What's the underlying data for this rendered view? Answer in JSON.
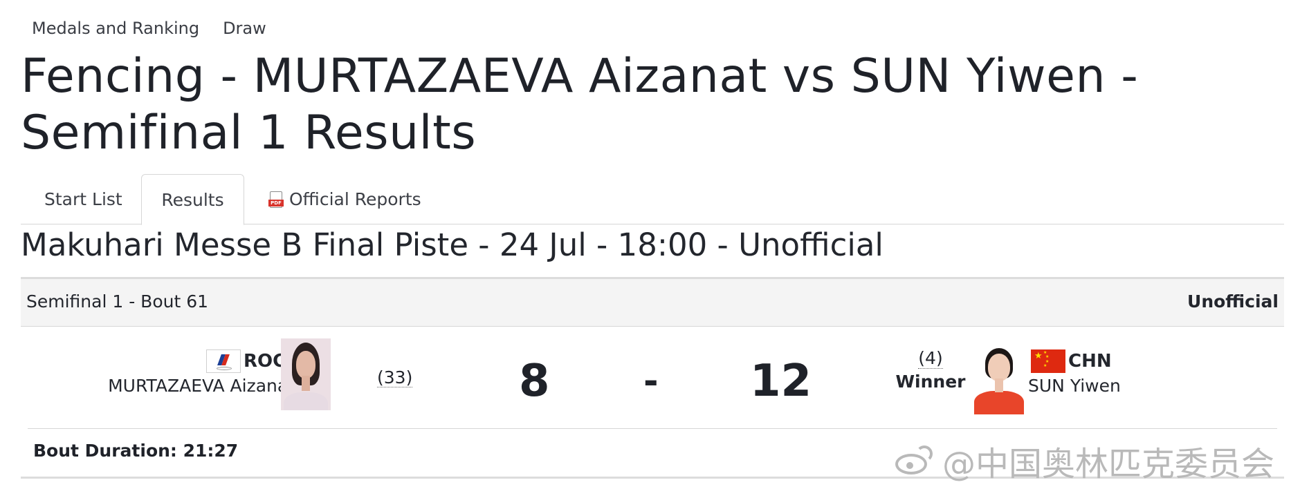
{
  "nav": {
    "items": [
      "Medals and Ranking",
      "Draw"
    ]
  },
  "page": {
    "title": "Fencing - MURTAZAEVA Aizanat vs SUN Yiwen - Semifinal 1 Results"
  },
  "tabs": {
    "start_list": "Start List",
    "results": "Results",
    "official_reports": "Official Reports",
    "active": "Results",
    "pdf_icon_text": "PDF"
  },
  "venue": "Makuhari Messe B Final Piste - 24 Jul - 18:00 - Unofficial",
  "bout": {
    "title": "Semifinal 1 - Bout 61",
    "status": "Unofficial",
    "athlete1": {
      "noc": "ROC",
      "name": "MURTAZAEVA Aizanat",
      "seed": "(33)",
      "score": "8",
      "flag": "roc-flag"
    },
    "separator": "-",
    "athlete2": {
      "noc": "CHN",
      "name": "SUN Yiwen",
      "seed": "(4)",
      "score": "12",
      "result": "Winner",
      "flag": "chn-flag"
    },
    "duration": "Bout Duration: 21:27"
  },
  "watermark": "@中国奥林匹克委员会",
  "colors": {
    "text": "#23262d",
    "header_bg": "#f4f4f4",
    "border": "#d6d6d6",
    "chn_red": "#de2910",
    "watermark": "#b9b9b9"
  }
}
